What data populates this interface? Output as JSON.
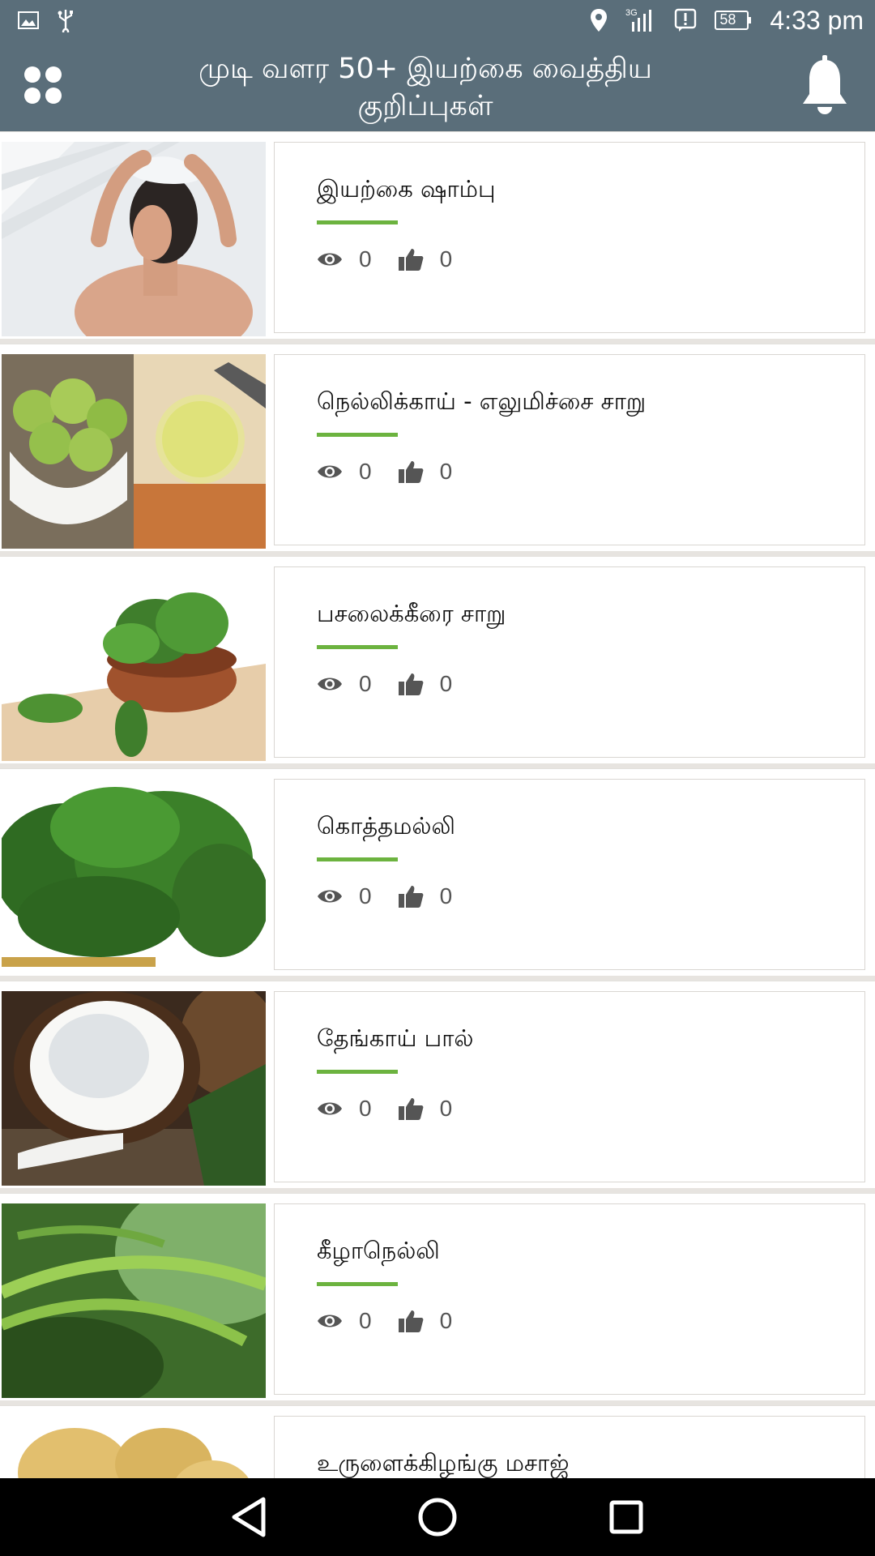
{
  "status_bar": {
    "time": "4:33 pm",
    "battery": "58",
    "network": "3G",
    "icons": [
      "image-icon",
      "usb-icon",
      "location-icon",
      "signal-icon",
      "alert-icon",
      "battery-icon"
    ]
  },
  "app_bar": {
    "title_line1": "முடி வளர 50+ இயற்கை வைத்திய",
    "title_line2": "குறிப்புகள்",
    "menu_icon": "grid-dots-icon",
    "bell_icon": "bell-icon",
    "color": "#5a6e7a"
  },
  "accent_color": "#6cb33f",
  "remedies": [
    {
      "title": "இயற்கை ஷாம்பு",
      "views": "0",
      "likes": "0",
      "image": "woman-shampoo"
    },
    {
      "title": "நெல்லிக்காய் - எலுமிச்சை சாறு",
      "views": "0",
      "likes": "0",
      "image": "gooseberry-lemon"
    },
    {
      "title": "பசலைக்கீரை சாறு",
      "views": "0",
      "likes": "0",
      "image": "spinach-bowl"
    },
    {
      "title": "கொத்தமல்லி",
      "views": "0",
      "likes": "0",
      "image": "coriander"
    },
    {
      "title": "தேங்காய் பால்",
      "views": "0",
      "likes": "0",
      "image": "coconut-milk"
    },
    {
      "title": "கீழாநெல்லி",
      "views": "0",
      "likes": "0",
      "image": "phyllanthus-leaves"
    },
    {
      "title": "உருளைக்கிழங்கு மசாஜ்",
      "views": "",
      "likes": "",
      "image": "potatoes"
    }
  ],
  "nav_bar": {
    "back": "back-icon",
    "home": "home-icon",
    "recents": "recents-icon"
  }
}
